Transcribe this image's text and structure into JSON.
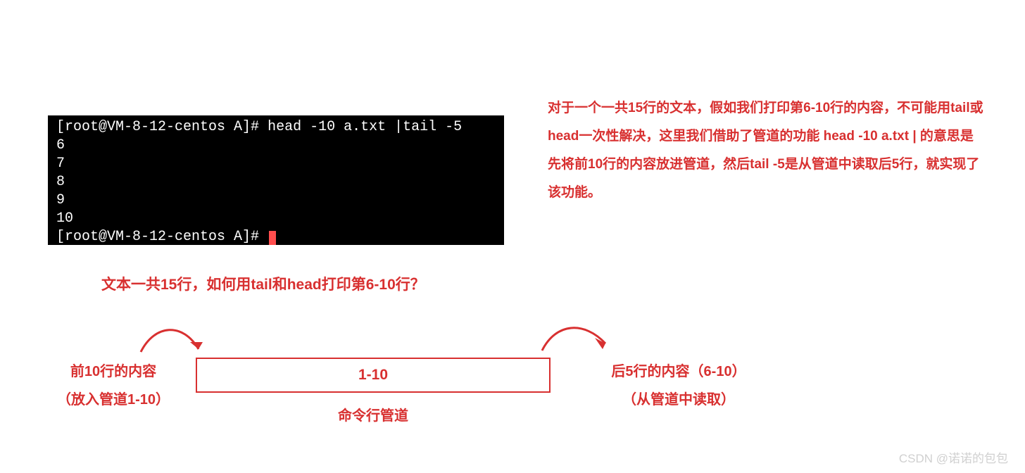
{
  "terminal": {
    "prompt1": "[root@VM-8-12-centos A]# ",
    "command": "head -10 a.txt |tail -5",
    "output": [
      "6",
      "7",
      "8",
      "9",
      "10"
    ],
    "prompt2": "[root@VM-8-12-centos A]# "
  },
  "explain": {
    "text": "对于一个一共15行的文本，假如我们打印第6-10行的内容，不可能用tail或head一次性解决，这里我们借助了管道的功能 head -10 a.txt | 的意思是先将前10行的内容放进管道，然后tail -5是从管道中读取后5行，就实现了该功能。"
  },
  "question": "文本一共15行，如何用tail和head打印第6-10行？",
  "diagram": {
    "left_line1": "前10行的内容",
    "left_line2": "（放入管道1-10）",
    "right_line1": "后5行的内容（6-10）",
    "right_line2": "（从管道中读取）",
    "pipe_content": "1-10",
    "pipe_label": "命令行管道"
  },
  "watermark": "CSDN @诺诺的包包",
  "colors": {
    "accent": "#d83030",
    "terminal_bg": "#000000",
    "terminal_fg": "#ffffff"
  }
}
